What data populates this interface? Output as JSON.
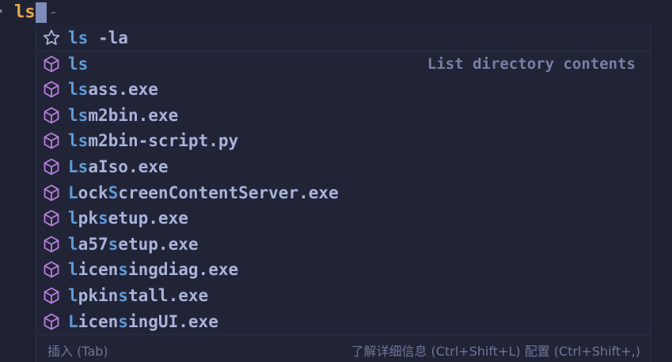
{
  "prompt": {
    "command": "ls",
    "ghost": " -la"
  },
  "suggestions": [
    {
      "label": "ls -la",
      "icon": "star-icon",
      "match": [
        0,
        1
      ]
    },
    {
      "label": "ls",
      "icon": "package-icon",
      "match": [
        0,
        1
      ],
      "description": "List directory contents"
    },
    {
      "label": "lsass.exe",
      "icon": "package-icon",
      "match": [
        0,
        1
      ]
    },
    {
      "label": "lsm2bin.exe",
      "icon": "package-icon",
      "match": [
        0,
        1
      ]
    },
    {
      "label": "lsm2bin-script.py",
      "icon": "package-icon",
      "match": [
        0,
        1
      ]
    },
    {
      "label": "LsaIso.exe",
      "icon": "package-icon",
      "match": [
        0,
        1
      ]
    },
    {
      "label": "LockScreenContentServer.exe",
      "icon": "package-icon",
      "match": [
        0,
        4
      ]
    },
    {
      "label": "lpksetup.exe",
      "icon": "package-icon",
      "match": [
        0,
        3
      ]
    },
    {
      "label": "la57setup.exe",
      "icon": "package-icon",
      "match": [
        0,
        4
      ]
    },
    {
      "label": "licensingdiag.exe",
      "icon": "package-icon",
      "match": [
        0,
        5
      ]
    },
    {
      "label": "lpkinstall.exe",
      "icon": "package-icon",
      "match": [
        0,
        5
      ]
    },
    {
      "label": "LicensingUI.exe",
      "icon": "package-icon",
      "match": [
        0,
        5
      ]
    }
  ],
  "footer": {
    "insert": "插入 (Tab)",
    "details": "了解详细信息 (Ctrl+Shift+L)  配置 (Ctrl+Shift+,)"
  },
  "colors": {
    "match": "#5f9ad8",
    "text": "#aab3d9",
    "package": "#b77fdb",
    "star": "#aab3d9"
  }
}
